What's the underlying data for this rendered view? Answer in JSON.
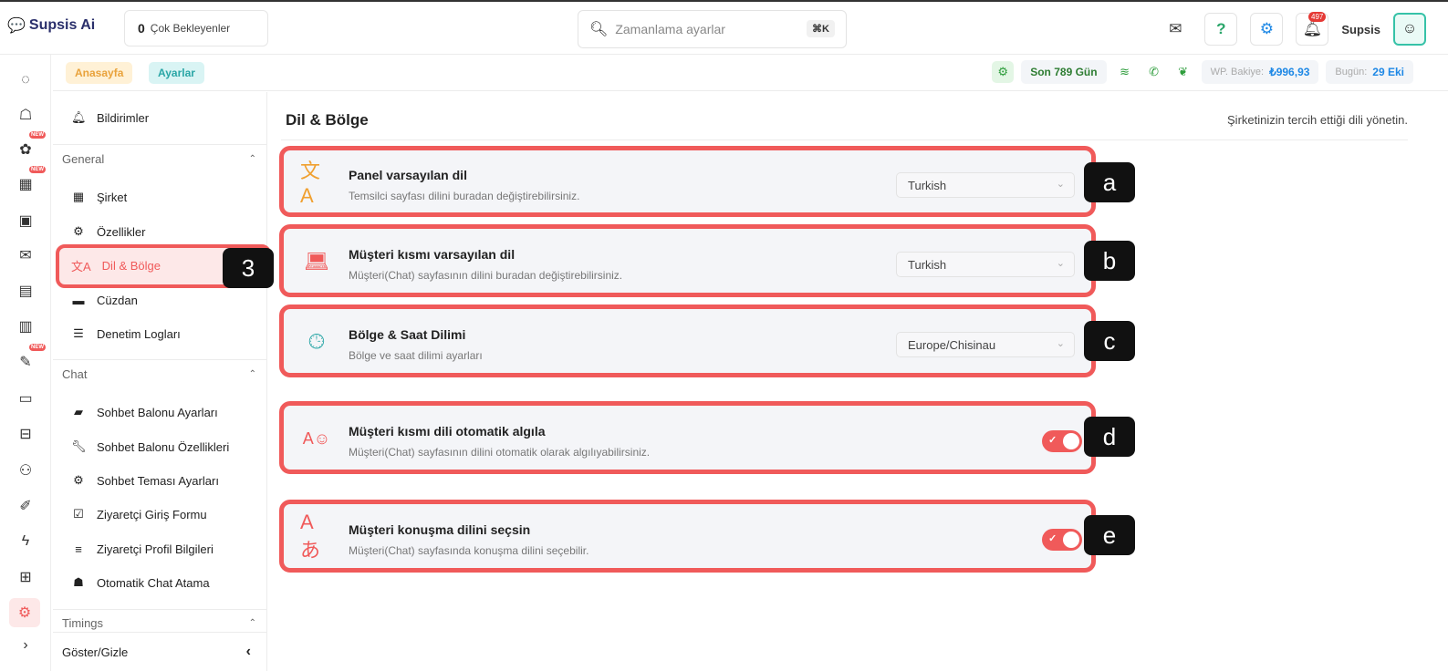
{
  "app": {
    "name": "Supsis Ai"
  },
  "header": {
    "pending_count": "0",
    "pending_label": "Çok Bekleyenler",
    "search_placeholder": "Zamanlama ayarlar",
    "search_shortcut": "⌘K",
    "notification_count": "497",
    "username": "Supsis"
  },
  "breadcrumb": {
    "home": "Anasayfa",
    "current": "Ayarlar"
  },
  "stats": {
    "days_label": "Son 789 Gün",
    "wp_label": "WP. Bakiye:",
    "wp_value": "₺996,93",
    "today_label": "Bugün:",
    "today_value": "29 Eki"
  },
  "rail": {
    "new_badge": "NEW"
  },
  "sidebar": {
    "notifications": "Bildirimler",
    "general_section": "General",
    "company": "Şirket",
    "features": "Özellikler",
    "language_region": "Dil & Bölge",
    "wallet": "Cüzdan",
    "audit_logs": "Denetim Logları",
    "chat_section": "Chat",
    "chat_items": [
      "Sohbet Balonu Ayarları",
      "Sohbet Balonu Özellikleri",
      "Sohbet Teması Ayarları",
      "Ziyaretçi Giriş Formu",
      "Ziyaretçi Profil Bilgileri",
      "Otomatik Chat Atama"
    ],
    "timings_section": "Timings",
    "footer": "Göster/Gizle"
  },
  "markers": {
    "sidebar": "3",
    "a": "a",
    "b": "b",
    "c": "c",
    "d": "d",
    "e": "e"
  },
  "main": {
    "title": "Dil & Bölge",
    "subtitle": "Şirketinizin tercih ettiği dili yönetin.",
    "cards": [
      {
        "title": "Panel varsayılan dil",
        "desc": "Temsilci sayfası dilini buradan değiştirebilirsiniz.",
        "value": "Turkish"
      },
      {
        "title": "Müşteri kısmı varsayılan dil",
        "desc": "Müşteri(Chat) sayfasının dilini buradan değiştirebilirsiniz.",
        "value": "Turkish"
      },
      {
        "title": "Bölge & Saat Dilimi",
        "desc": "Bölge ve saat dilimi ayarları",
        "value": "Europe/Chisinau"
      },
      {
        "title": "Müşteri kısmı dili otomatik algıla",
        "desc": "Müşteri(Chat) sayfasının dilini otomatik olarak algılıyabilirsiniz.",
        "toggle": true
      },
      {
        "title": "Müşteri konuşma dilini seçsin",
        "desc": "Müşteri(Chat) sayfasında konuşma dilini seçebilir.",
        "toggle": true
      }
    ]
  },
  "colors": {
    "accent": "#f05a5a",
    "brand": "#2a2f6b",
    "card_bg": "#f4f5f8"
  }
}
